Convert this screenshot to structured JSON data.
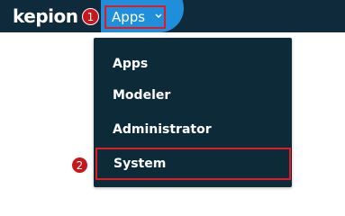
{
  "header": {
    "logo_text": "kepion",
    "apps_label": "Apps",
    "chevron_icon": "chevron-down-icon"
  },
  "annotations": {
    "step1": "1",
    "step2": "2"
  },
  "menu": {
    "items": [
      {
        "label": "Apps"
      },
      {
        "label": "Modeler"
      },
      {
        "label": "Administrator"
      },
      {
        "label": "System"
      }
    ]
  },
  "colors": {
    "topbar": "#0f2b3b",
    "accent": "#1f8fdc",
    "highlight": "#e01b24",
    "badge": "#c8171c",
    "menu_bg": "#0d2a39"
  }
}
